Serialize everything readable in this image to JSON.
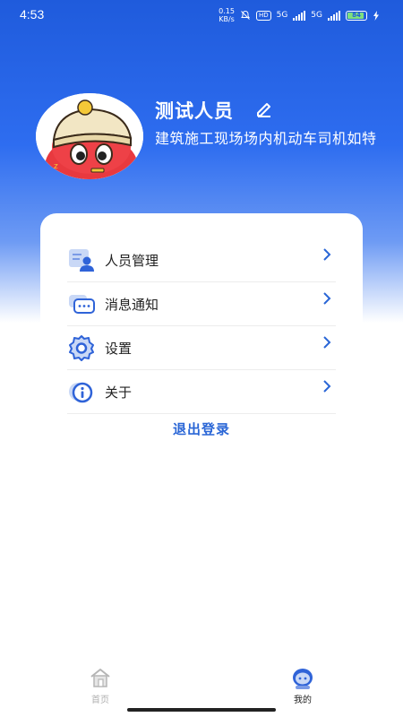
{
  "status_bar": {
    "time": "4:53",
    "net_speed_value": "0.15",
    "net_speed_unit": "KB/s",
    "hd": "HD",
    "network_1": "5G",
    "network_2": "5G",
    "battery": "84"
  },
  "profile": {
    "name": "测试人员",
    "role": "建筑施工现场场内机动车司机如特"
  },
  "menu": {
    "items": [
      {
        "label": "人员管理",
        "icon": "personnel-icon"
      },
      {
        "label": "消息通知",
        "icon": "message-icon"
      },
      {
        "label": "设置",
        "icon": "gear-icon"
      },
      {
        "label": "关于",
        "icon": "info-icon"
      }
    ],
    "logout_label": "退出登录"
  },
  "tab_bar": {
    "home_label": "首页",
    "mine_label": "我的"
  },
  "colors": {
    "primary": "#2a66d6",
    "hero_top": "#1f5bdc",
    "icon_blue": "#3f6fdc"
  }
}
